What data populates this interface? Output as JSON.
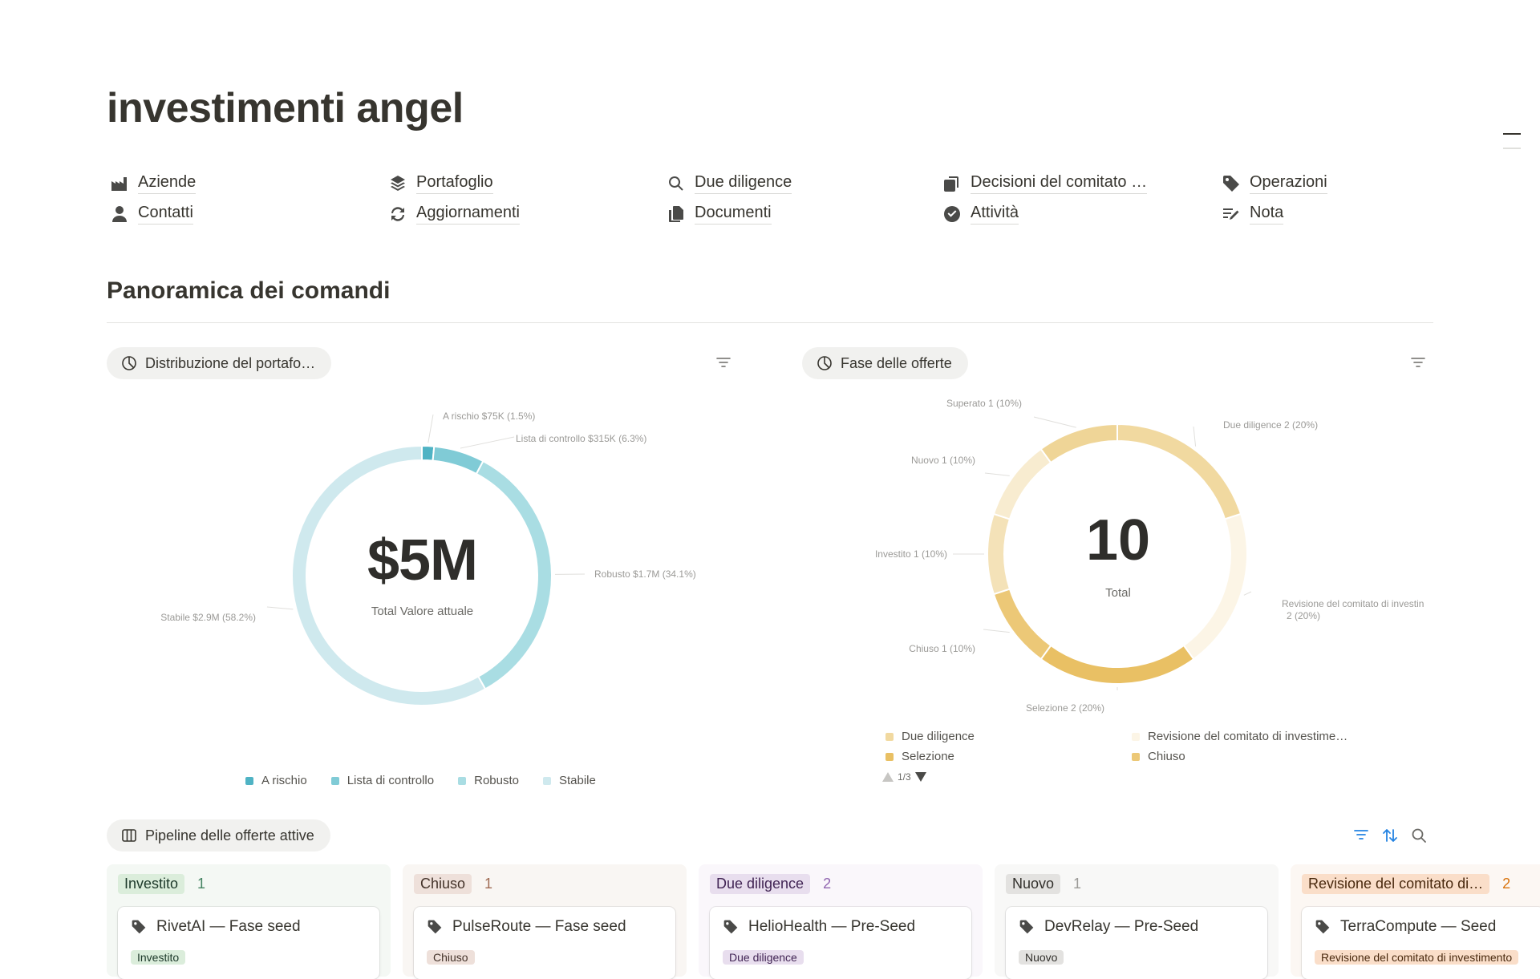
{
  "page": {
    "title": "investimenti angel"
  },
  "nav": [
    {
      "label": "Aziende",
      "icon": "factory-icon"
    },
    {
      "label": "Portafoglio",
      "icon": "layers-icon"
    },
    {
      "label": "Due diligence",
      "icon": "search-icon"
    },
    {
      "label": "Decisioni del comitato …",
      "icon": "copy-icon"
    },
    {
      "label": "Operazioni",
      "icon": "tag-icon"
    },
    {
      "label": "Contatti",
      "icon": "person-icon"
    },
    {
      "label": "Aggiornamenti",
      "icon": "refresh-icon"
    },
    {
      "label": "Documenti",
      "icon": "documents-icon"
    },
    {
      "label": "Attività",
      "icon": "check-circle-icon"
    },
    {
      "label": "Nota",
      "icon": "note-edit-icon"
    }
  ],
  "section": {
    "heading": "Panoramica dei comandi"
  },
  "portfolio_view": {
    "label": "Distribuzione del portafo…",
    "icon": "pie-chart-icon"
  },
  "offers_view": {
    "label": "Fase delle offerte",
    "icon": "pie-chart-icon"
  },
  "pipeline_view": {
    "label": "Pipeline delle offerte attive",
    "icon": "board-icon"
  },
  "chart_data": [
    {
      "type": "pie",
      "donut": true,
      "center_value": "$5M",
      "center_label": "Total Valore attuale",
      "slices": [
        {
          "name": "A rischio",
          "value": 75000,
          "display": "$75K",
          "pct": "1.5%",
          "color": "#4fb3c4"
        },
        {
          "name": "Lista di controllo",
          "value": 315000,
          "display": "$315K",
          "pct": "6.3%",
          "color": "#80cbd6"
        },
        {
          "name": "Robusto",
          "value": 1700000,
          "display": "$1.7M",
          "pct": "34.1%",
          "color": "#a9dde3"
        },
        {
          "name": "Stabile",
          "value": 2900000,
          "display": "$2.9M",
          "pct": "58.2%",
          "color": "#cfe9ee"
        }
      ],
      "legend": [
        "A rischio",
        "Lista di controllo",
        "Robusto",
        "Stabile"
      ]
    },
    {
      "type": "pie",
      "donut": true,
      "center_value": "10",
      "center_label": "Total",
      "slices": [
        {
          "name": "Due diligence",
          "value": 2,
          "display": "2",
          "pct": "20%",
          "color": "#f1d9a0"
        },
        {
          "name": "Revisione del comitato di investin",
          "value": 2,
          "display": "2",
          "pct": "20%",
          "color": "#fcf5e6"
        },
        {
          "name": "Selezione",
          "value": 2,
          "display": "2",
          "pct": "20%",
          "color": "#e9c064"
        },
        {
          "name": "Chiuso",
          "value": 1,
          "display": "1",
          "pct": "10%",
          "color": "#ecc877"
        },
        {
          "name": "Investito",
          "value": 1,
          "display": "1",
          "pct": "10%",
          "color": "#f4e2b8"
        },
        {
          "name": "Nuovo",
          "value": 1,
          "display": "1",
          "pct": "10%",
          "color": "#f8ecd0"
        },
        {
          "name": "Superato",
          "value": 1,
          "display": "1",
          "pct": "10%",
          "color": "#efd597"
        }
      ],
      "legend": [
        {
          "name": "Due diligence",
          "color": "#f1d9a0"
        },
        {
          "name": "Revisione del comitato di investime…",
          "color": "#fcf5e6"
        },
        {
          "name": "Selezione",
          "color": "#e9c064"
        },
        {
          "name": "Chiuso",
          "color": "#ecc877"
        }
      ],
      "legend_page": "1/3"
    }
  ],
  "pipeline": [
    {
      "tag": "Investito",
      "count": "1",
      "card": "RivetAI — Fase seed",
      "card_tag": "Investito",
      "tag_bg": "#dbeddb",
      "tag_fg": "#1c3829",
      "count_fg": "#448361",
      "col_bg": "#f4f8f4"
    },
    {
      "tag": "Chiuso",
      "count": "1",
      "card": "PulseRoute — Fase seed",
      "card_tag": "Chiuso",
      "tag_bg": "#eee0da",
      "tag_fg": "#44332a",
      "count_fg": "#9f6b53",
      "col_bg": "#f9f6f3"
    },
    {
      "tag": "Due diligence",
      "count": "2",
      "card": "HelioHealth — Pre-Seed",
      "card_tag": "Due diligence",
      "tag_bg": "#e8deee",
      "tag_fg": "#412454",
      "count_fg": "#9065b0",
      "col_bg": "#faf7fb"
    },
    {
      "tag": "Nuovo",
      "count": "1",
      "card": "DevRelay — Pre-Seed",
      "card_tag": "Nuovo",
      "tag_bg": "#e3e2e0",
      "tag_fg": "#32302c",
      "count_fg": "#9b9a97",
      "col_bg": "#f8f8f7"
    },
    {
      "tag": "Revisione del comitato di…",
      "count": "2",
      "card": "TerraCompute — Seed",
      "card_tag": "Revisione del comitato di investimento",
      "tag_bg": "#fadec9",
      "tag_fg": "#49290e",
      "count_fg": "#d9730d",
      "col_bg": "#fcf7f3"
    }
  ]
}
